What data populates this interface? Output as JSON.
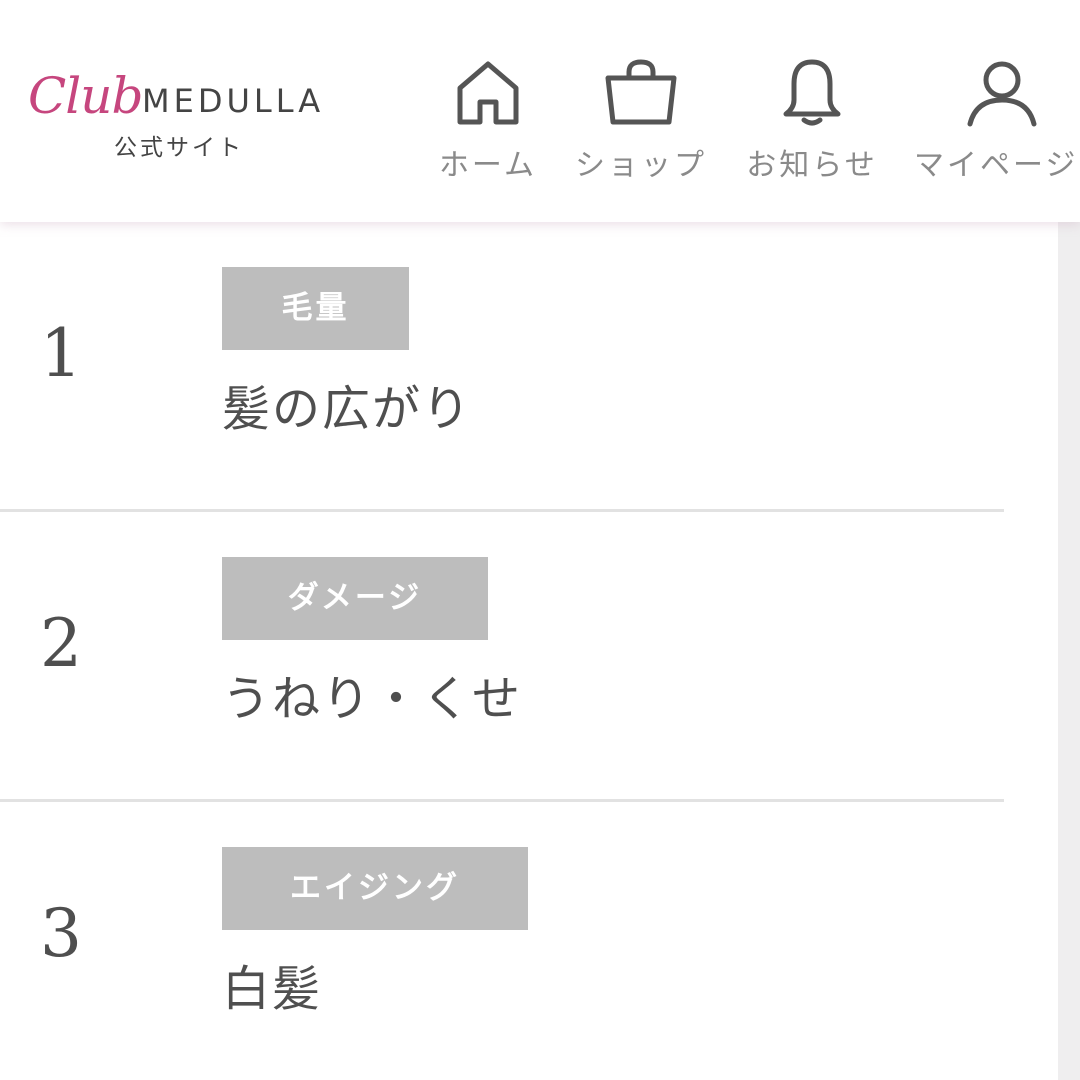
{
  "header": {
    "logo": {
      "script": "Club",
      "brand": "MEDULLA",
      "subtitle": "公式サイト"
    },
    "nav": [
      {
        "label": "ホーム",
        "icon": "home-icon"
      },
      {
        "label": "ショップ",
        "icon": "shopping-bag-icon"
      },
      {
        "label": "お知らせ",
        "icon": "bell-icon"
      },
      {
        "label": "マイページ",
        "icon": "user-icon"
      }
    ]
  },
  "colors": {
    "brand_pink": "#c6467e",
    "tag_background": "#bdbdbd",
    "text": "#4f4f4f",
    "nav_text": "#8a8a8a"
  },
  "ranking": [
    {
      "rank": "1",
      "tag": "毛量",
      "title": "髪の広がり"
    },
    {
      "rank": "2",
      "tag": "ダメージ",
      "title": "うねり・くせ"
    },
    {
      "rank": "3",
      "tag": "エイジング",
      "title": "白髪"
    }
  ]
}
